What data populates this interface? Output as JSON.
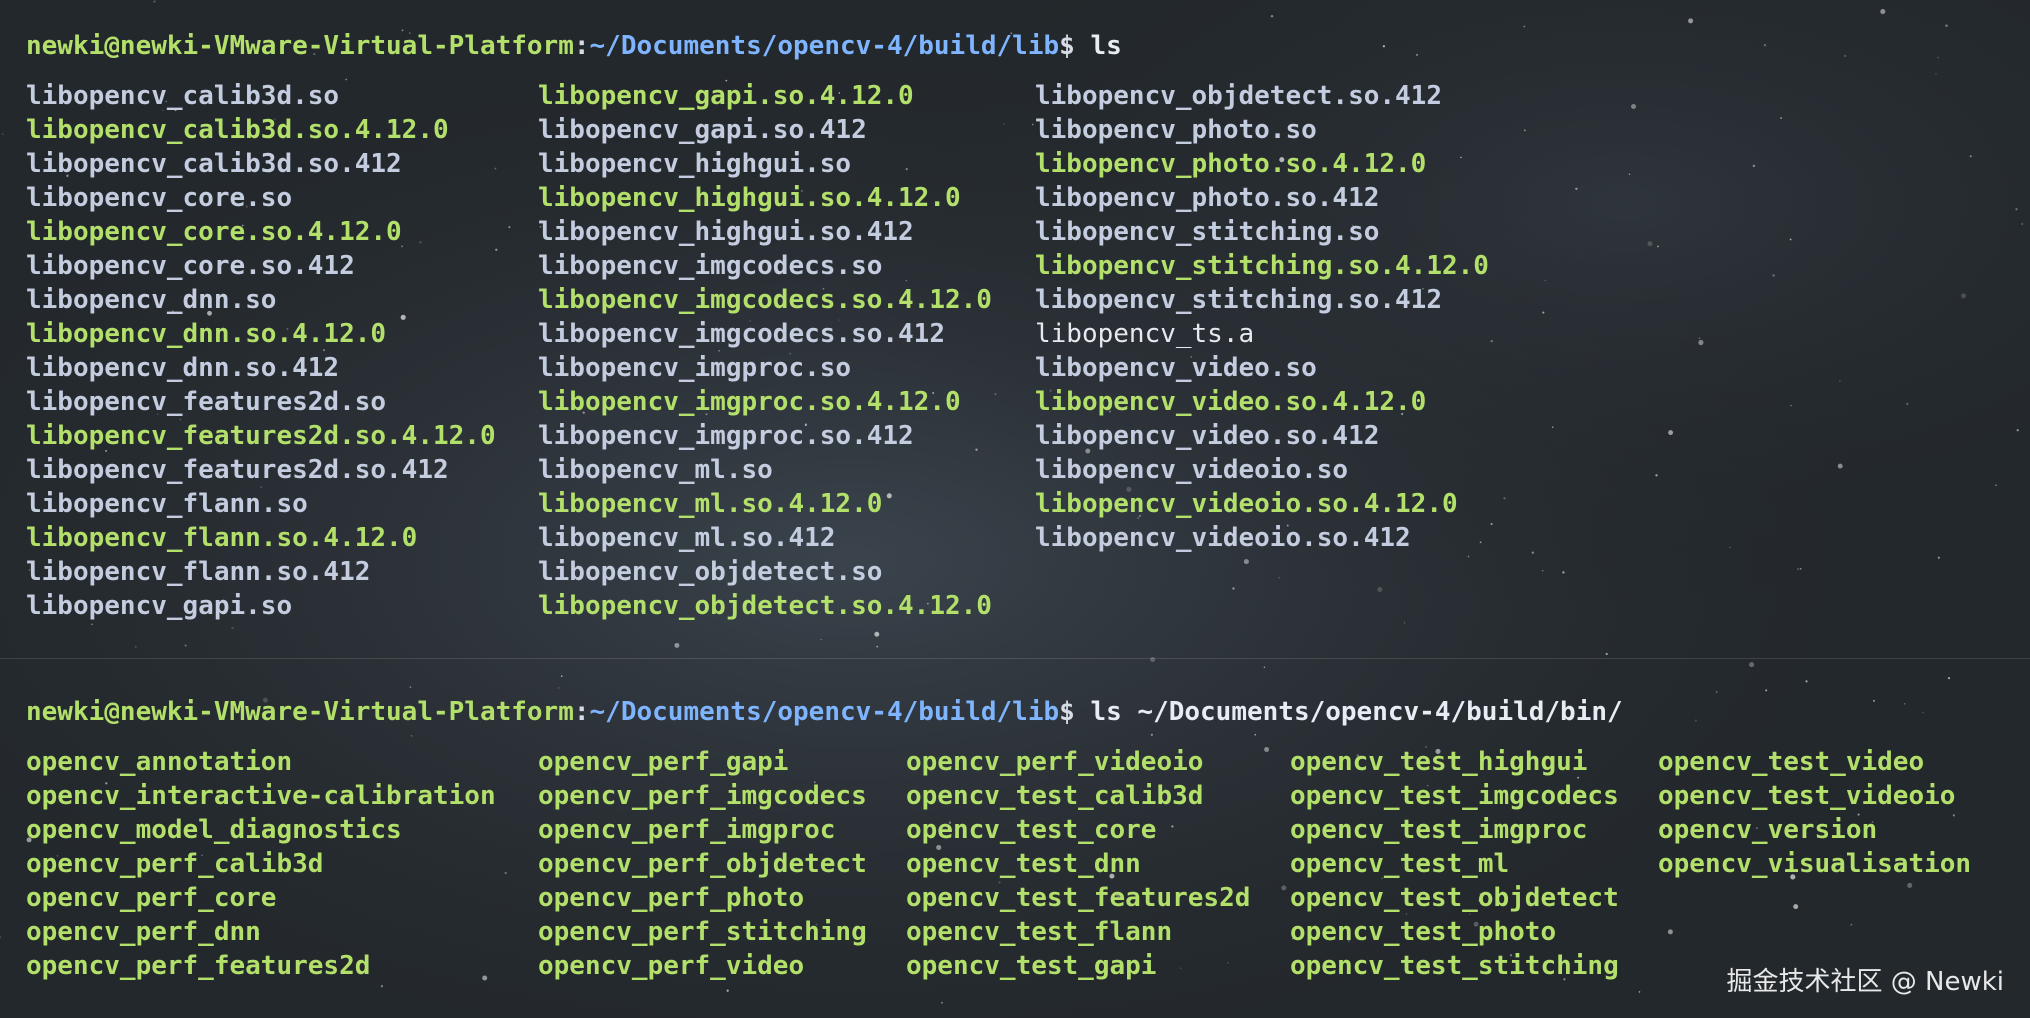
{
  "colors": {
    "prompt_user": "#b3e06a",
    "prompt_path": "#7fb4ff",
    "library_file": "#c4cddf",
    "versioned_library": "#b3e06a",
    "executable": "#b3e06a",
    "background": "#262b2f"
  },
  "pane1": {
    "prompt": {
      "user_host": "newki@newki-VMware-Virtual-Platform",
      "colon": ":",
      "path": "~/Documents/opencv-4/build/lib",
      "dollar": "$ ",
      "command": "ls"
    },
    "columns": [
      [
        {
          "name": "libopencv_calib3d.so",
          "kind": "lib"
        },
        {
          "name": "libopencv_calib3d.so.4.12.0",
          "kind": "ver"
        },
        {
          "name": "libopencv_calib3d.so.412",
          "kind": "lib"
        },
        {
          "name": "libopencv_core.so",
          "kind": "lib"
        },
        {
          "name": "libopencv_core.so.4.12.0",
          "kind": "ver"
        },
        {
          "name": "libopencv_core.so.412",
          "kind": "lib"
        },
        {
          "name": "libopencv_dnn.so",
          "kind": "lib"
        },
        {
          "name": "libopencv_dnn.so.4.12.0",
          "kind": "ver"
        },
        {
          "name": "libopencv_dnn.so.412",
          "kind": "lib"
        },
        {
          "name": "libopencv_features2d.so",
          "kind": "lib"
        },
        {
          "name": "libopencv_features2d.so.4.12.0",
          "kind": "ver"
        },
        {
          "name": "libopencv_features2d.so.412",
          "kind": "lib"
        },
        {
          "name": "libopencv_flann.so",
          "kind": "lib"
        },
        {
          "name": "libopencv_flann.so.4.12.0",
          "kind": "ver"
        },
        {
          "name": "libopencv_flann.so.412",
          "kind": "lib"
        },
        {
          "name": "libopencv_gapi.so",
          "kind": "lib"
        }
      ],
      [
        {
          "name": "libopencv_gapi.so.4.12.0",
          "kind": "ver"
        },
        {
          "name": "libopencv_gapi.so.412",
          "kind": "lib"
        },
        {
          "name": "libopencv_highgui.so",
          "kind": "lib"
        },
        {
          "name": "libopencv_highgui.so.4.12.0",
          "kind": "ver"
        },
        {
          "name": "libopencv_highgui.so.412",
          "kind": "lib"
        },
        {
          "name": "libopencv_imgcodecs.so",
          "kind": "lib"
        },
        {
          "name": "libopencv_imgcodecs.so.4.12.0",
          "kind": "ver"
        },
        {
          "name": "libopencv_imgcodecs.so.412",
          "kind": "lib"
        },
        {
          "name": "libopencv_imgproc.so",
          "kind": "lib"
        },
        {
          "name": "libopencv_imgproc.so.4.12.0",
          "kind": "ver"
        },
        {
          "name": "libopencv_imgproc.so.412",
          "kind": "lib"
        },
        {
          "name": "libopencv_ml.so",
          "kind": "lib"
        },
        {
          "name": "libopencv_ml.so.4.12.0",
          "kind": "ver"
        },
        {
          "name": "libopencv_ml.so.412",
          "kind": "lib"
        },
        {
          "name": "libopencv_objdetect.so",
          "kind": "lib"
        },
        {
          "name": "libopencv_objdetect.so.4.12.0",
          "kind": "ver"
        }
      ],
      [
        {
          "name": "libopencv_objdetect.so.412",
          "kind": "lib"
        },
        {
          "name": "libopencv_photo.so",
          "kind": "lib"
        },
        {
          "name": "libopencv_photo.so.4.12.0",
          "kind": "ver"
        },
        {
          "name": "libopencv_photo.so.412",
          "kind": "lib"
        },
        {
          "name": "libopencv_stitching.so",
          "kind": "lib"
        },
        {
          "name": "libopencv_stitching.so.4.12.0",
          "kind": "ver"
        },
        {
          "name": "libopencv_stitching.so.412",
          "kind": "lib"
        },
        {
          "name": "libopencv_ts.a",
          "kind": "static"
        },
        {
          "name": "libopencv_video.so",
          "kind": "lib"
        },
        {
          "name": "libopencv_video.so.4.12.0",
          "kind": "ver"
        },
        {
          "name": "libopencv_video.so.412",
          "kind": "lib"
        },
        {
          "name": "libopencv_videoio.so",
          "kind": "lib"
        },
        {
          "name": "libopencv_videoio.so.4.12.0",
          "kind": "ver"
        },
        {
          "name": "libopencv_videoio.so.412",
          "kind": "lib"
        }
      ]
    ]
  },
  "pane2": {
    "prompt": {
      "user_host": "newki@newki-VMware-Virtual-Platform",
      "colon": ":",
      "path": "~/Documents/opencv-4/build/lib",
      "dollar": "$ ",
      "command": "ls ~/Documents/opencv-4/build/bin/"
    },
    "columns": [
      [
        {
          "name": "opencv_annotation",
          "kind": "exe"
        },
        {
          "name": "opencv_interactive-calibration",
          "kind": "exe"
        },
        {
          "name": "opencv_model_diagnostics",
          "kind": "exe"
        },
        {
          "name": "opencv_perf_calib3d",
          "kind": "exe"
        },
        {
          "name": "opencv_perf_core",
          "kind": "exe"
        },
        {
          "name": "opencv_perf_dnn",
          "kind": "exe"
        },
        {
          "name": "opencv_perf_features2d",
          "kind": "exe"
        }
      ],
      [
        {
          "name": "opencv_perf_gapi",
          "kind": "exe"
        },
        {
          "name": "opencv_perf_imgcodecs",
          "kind": "exe"
        },
        {
          "name": "opencv_perf_imgproc",
          "kind": "exe"
        },
        {
          "name": "opencv_perf_objdetect",
          "kind": "exe"
        },
        {
          "name": "opencv_perf_photo",
          "kind": "exe"
        },
        {
          "name": "opencv_perf_stitching",
          "kind": "exe"
        },
        {
          "name": "opencv_perf_video",
          "kind": "exe"
        }
      ],
      [
        {
          "name": "opencv_perf_videoio",
          "kind": "exe"
        },
        {
          "name": "opencv_test_calib3d",
          "kind": "exe"
        },
        {
          "name": "opencv_test_core",
          "kind": "exe"
        },
        {
          "name": "opencv_test_dnn",
          "kind": "exe"
        },
        {
          "name": "opencv_test_features2d",
          "kind": "exe"
        },
        {
          "name": "opencv_test_flann",
          "kind": "exe"
        },
        {
          "name": "opencv_test_gapi",
          "kind": "exe"
        }
      ],
      [
        {
          "name": "opencv_test_highgui",
          "kind": "exe"
        },
        {
          "name": "opencv_test_imgcodecs",
          "kind": "exe"
        },
        {
          "name": "opencv_test_imgproc",
          "kind": "exe"
        },
        {
          "name": "opencv_test_ml",
          "kind": "exe"
        },
        {
          "name": "opencv_test_objdetect",
          "kind": "exe"
        },
        {
          "name": "opencv_test_photo",
          "kind": "exe"
        },
        {
          "name": "opencv_test_stitching",
          "kind": "exe"
        }
      ],
      [
        {
          "name": "opencv_test_video",
          "kind": "exe"
        },
        {
          "name": "opencv_test_videoio",
          "kind": "exe"
        },
        {
          "name": "opencv_version",
          "kind": "exe"
        },
        {
          "name": "opencv_visualisation",
          "kind": "exe"
        }
      ]
    ]
  },
  "watermark": "掘金技术社区 @ Newki"
}
